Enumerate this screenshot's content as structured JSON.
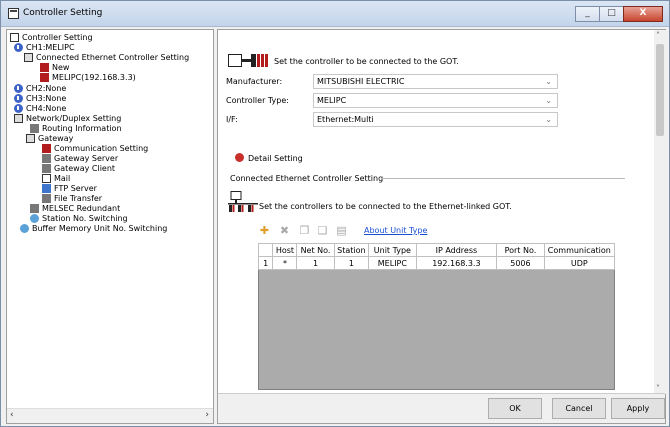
{
  "window": {
    "title": "Controller Setting",
    "controls": [
      "_",
      "□",
      "X"
    ]
  },
  "tree": {
    "nodes": [
      {
        "label": "Controller Setting",
        "icon": "pc-icon"
      },
      {
        "label": "CH1:MELIPC",
        "icon": "channel-icon"
      },
      {
        "label": "Connected Ethernet Controller Setting",
        "icon": "network-icon"
      },
      {
        "label": "New",
        "icon": "device-new-icon"
      },
      {
        "label": "MELIPC(192.168.3.3)",
        "icon": "device-icon"
      },
      {
        "label": "CH2:None",
        "icon": "channel-icon"
      },
      {
        "label": "CH3:None",
        "icon": "channel-icon"
      },
      {
        "label": "CH4:None",
        "icon": "channel-icon"
      },
      {
        "label": "Network/Duplex Setting",
        "icon": "network-icon"
      },
      {
        "label": "Routing Information",
        "icon": "routing-icon"
      },
      {
        "label": "Gateway",
        "icon": "gateway-icon"
      },
      {
        "label": "Communication Setting",
        "icon": "communication-icon"
      },
      {
        "label": "Gateway Server",
        "icon": "server-icon"
      },
      {
        "label": "Gateway Client",
        "icon": "client-icon"
      },
      {
        "label": "Mail",
        "icon": "mail-icon"
      },
      {
        "label": "FTP Server",
        "icon": "ftp-icon"
      },
      {
        "label": "File Transfer",
        "icon": "file-transfer-icon"
      },
      {
        "label": "MELSEC Redundant",
        "icon": "redundant-icon"
      },
      {
        "label": "Station No. Switching",
        "icon": "station-icon"
      },
      {
        "label": "Buffer Memory Unit No. Switching",
        "icon": "buffer-icon"
      }
    ]
  },
  "main": {
    "header_text": "Set the controller to be connected to the GOT.",
    "manufacturer_label": "Manufacturer:",
    "manufacturer_value": "MITSUBISHI ELECTRIC",
    "controller_type_label": "Controller Type:",
    "controller_type_value": "MELIPC",
    "if_label": "I/F:",
    "if_value": "Ethernet:Multi",
    "detail_setting": "Detail Setting",
    "section_title": "Connected Ethernet Controller Setting",
    "ethernet_text": "Set the controllers to be connected to the Ethernet-linked GOT.",
    "about_link": "About Unit Type"
  },
  "table": {
    "columns": [
      "",
      "Host",
      "Net No.",
      "Station",
      "Unit Type",
      "IP Address",
      "Port No.",
      "Communication"
    ],
    "rows": [
      [
        "1",
        "*",
        "1",
        "1",
        "MELIPC",
        "192.168.3.3",
        "5006",
        "UDP"
      ]
    ]
  },
  "buttons": {
    "ok": "OK",
    "cancel": "Cancel",
    "apply": "Apply"
  }
}
